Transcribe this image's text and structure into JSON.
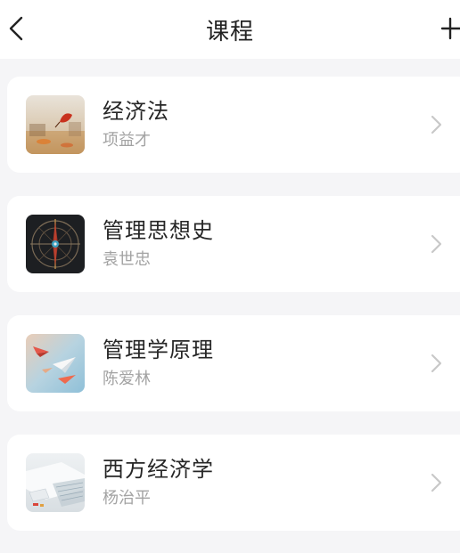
{
  "header": {
    "title": "课程",
    "back_icon": "chevron-left-icon",
    "add_icon": "plus-icon"
  },
  "courses": [
    {
      "name": "经济法",
      "teacher": "项益才",
      "thumb": "autumn-leaf"
    },
    {
      "name": "管理思想史",
      "teacher": "袁世忠",
      "thumb": "compass-dial"
    },
    {
      "name": "管理学原理",
      "teacher": "陈爱林",
      "thumb": "paper-planes"
    },
    {
      "name": "西方经济学",
      "teacher": "杨治平",
      "thumb": "keyboard-papers"
    }
  ],
  "colors": {
    "background": "#f5f5f7",
    "card": "#ffffff",
    "title_text": "#222222",
    "name_text": "#262626",
    "teacher_text": "#a3a3a3",
    "chevron": "#c8c8c8"
  }
}
